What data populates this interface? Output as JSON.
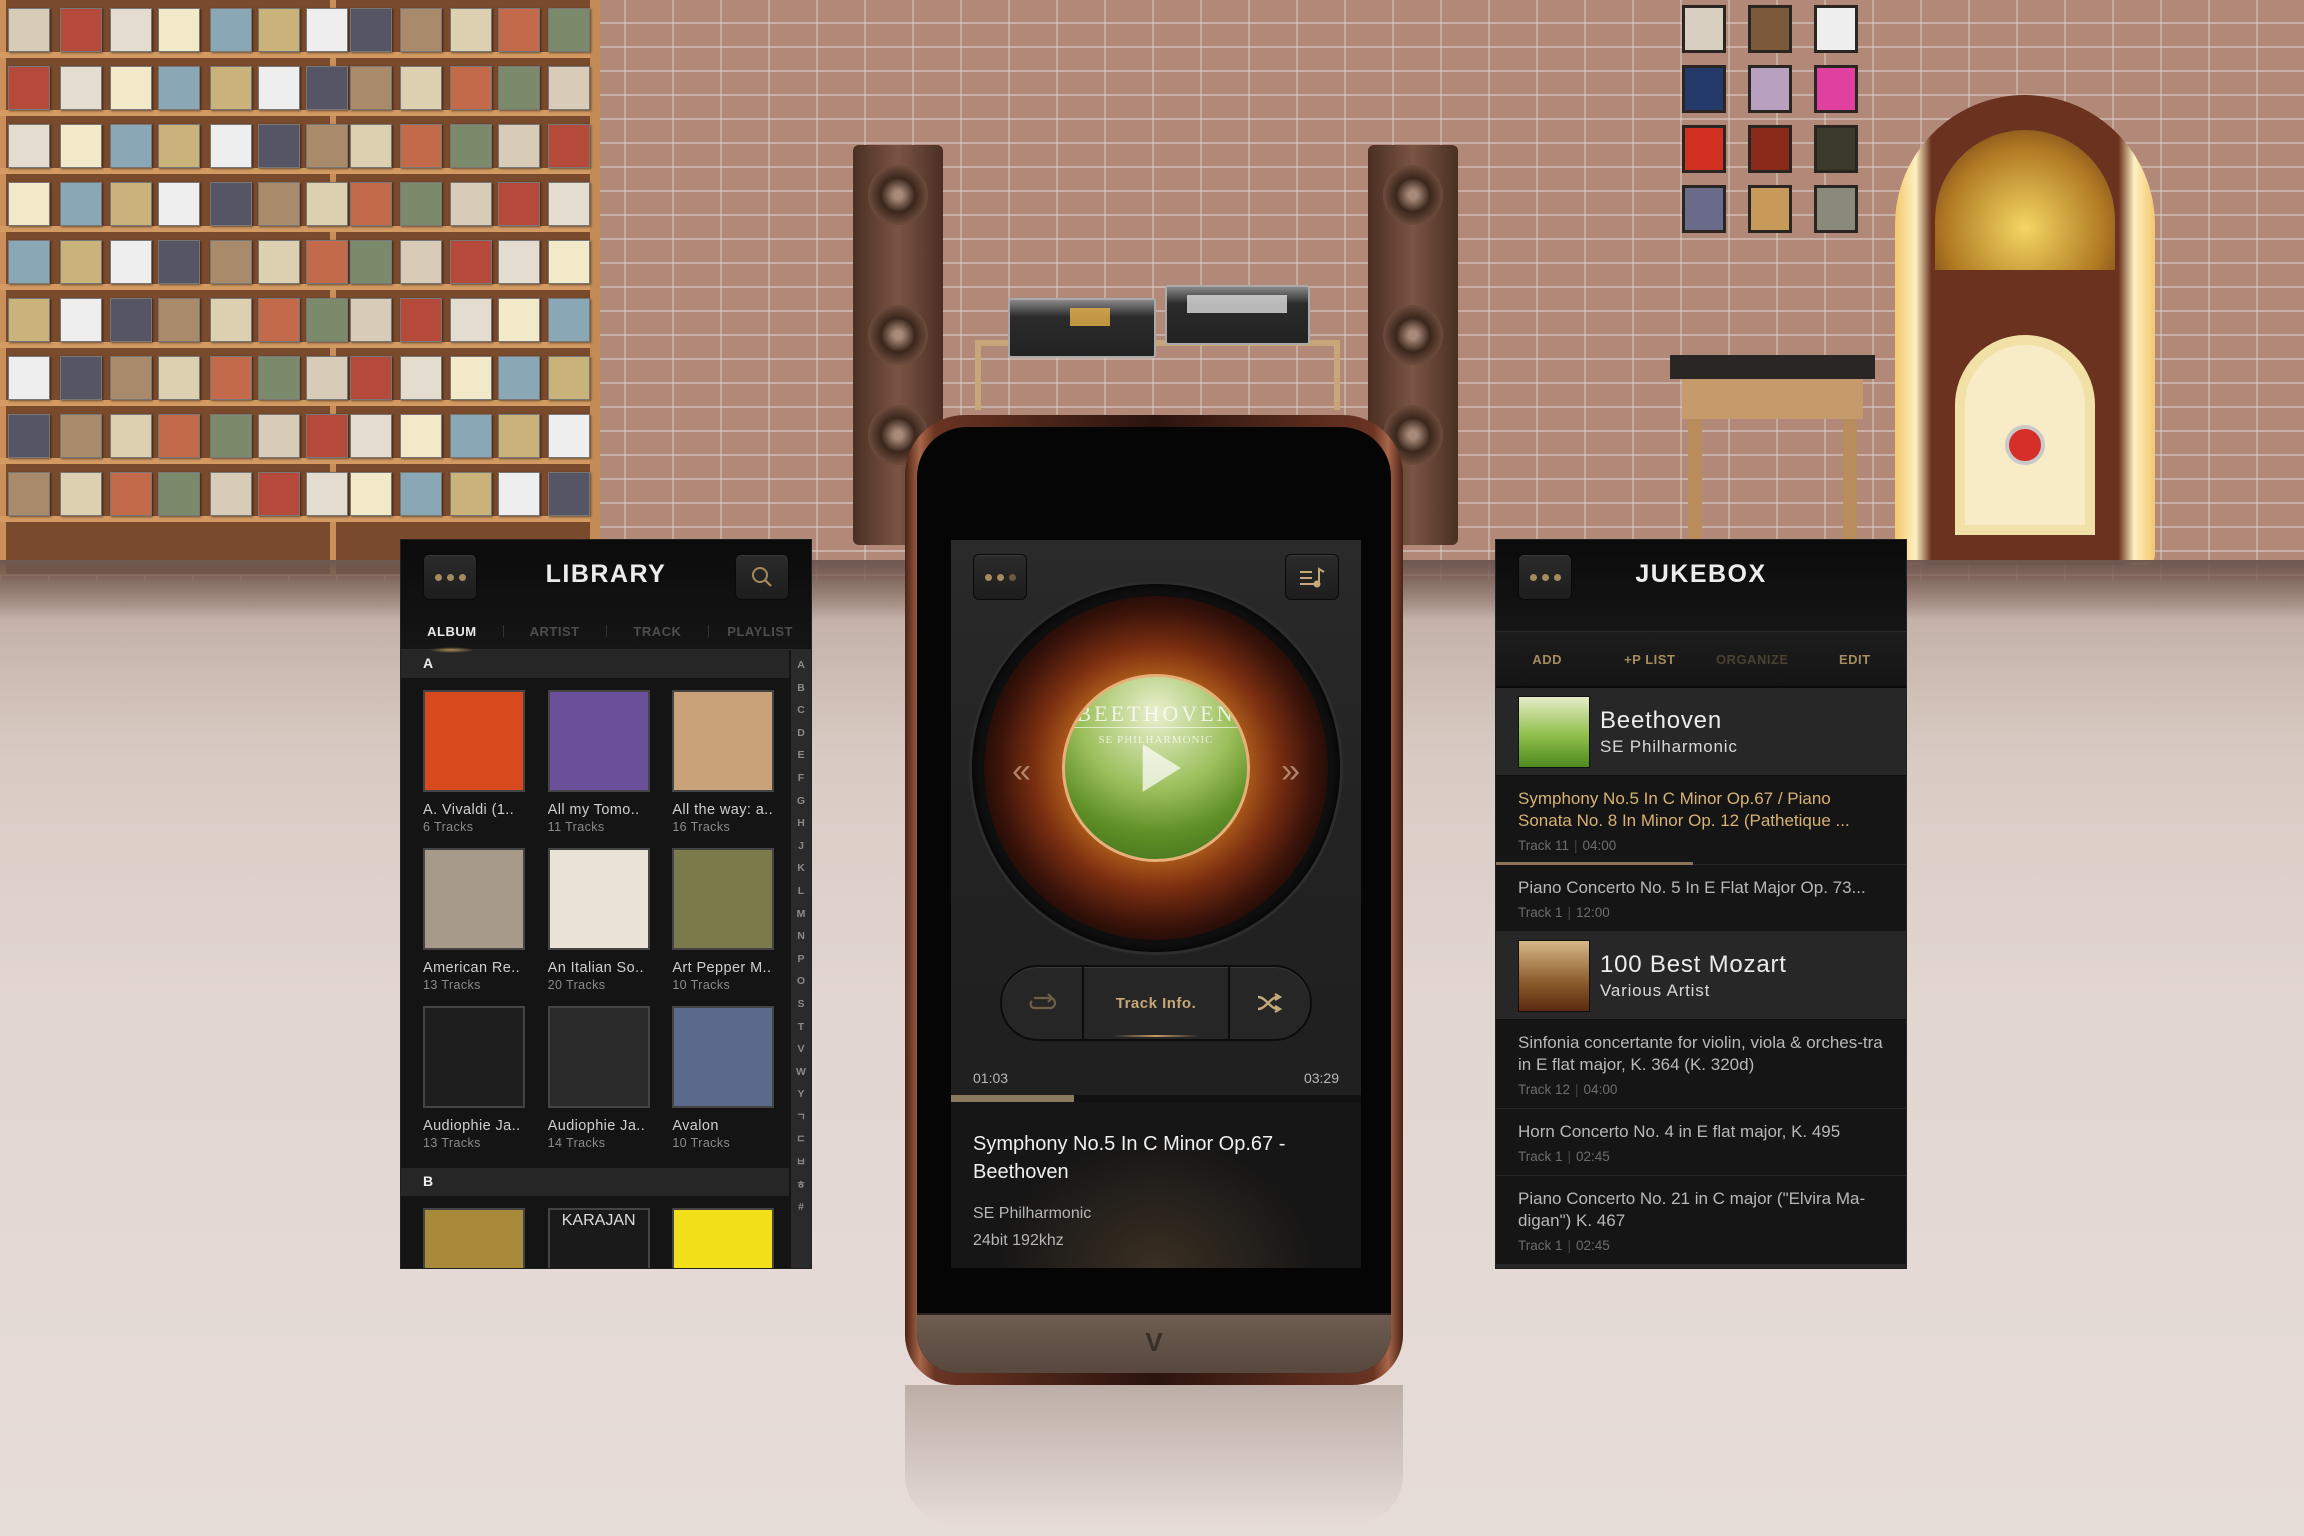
{
  "library": {
    "title": "LIBRARY",
    "tabs": [
      {
        "label": "ALBUM",
        "active": true
      },
      {
        "label": "ARTIST",
        "active": false
      },
      {
        "label": "TRACK",
        "active": false
      },
      {
        "label": "PLAYLIST",
        "active": false
      }
    ],
    "sections": [
      {
        "letter": "A",
        "albums": [
          {
            "title": "A. Vivaldi (1..",
            "tracks": "6 Tracks",
            "cover_color": "#d84a1e"
          },
          {
            "title": "All my Tomo..",
            "tracks": "11 Tracks",
            "cover_color": "#6a4f9a"
          },
          {
            "title": "All the way: a..",
            "tracks": "16 Tracks",
            "cover_color": "#c9a27a"
          },
          {
            "title": "American Re..",
            "tracks": "13 Tracks",
            "cover_color": "#a89a88"
          },
          {
            "title": "An Italian So..",
            "tracks": "20 Tracks",
            "cover_color": "#e9e3d6"
          },
          {
            "title": "Art Pepper M..",
            "tracks": "10 Tracks",
            "cover_color": "#7a7a4a"
          },
          {
            "title": "Audiophie Ja..",
            "tracks": "13 Tracks",
            "cover_color": "#1e1e1e"
          },
          {
            "title": "Audiophie Ja..",
            "tracks": "14 Tracks",
            "cover_color": "#2a2a2a"
          },
          {
            "title": "Avalon",
            "tracks": "10 Tracks",
            "cover_color": "#5a6a8a"
          }
        ]
      },
      {
        "letter": "B",
        "albums": [
          {
            "title": "",
            "tracks": "",
            "cover_color": "#a88a3a"
          },
          {
            "title": "",
            "tracks": "",
            "cover_label": "KARAJAN",
            "cover_color": "#1a1a1a"
          },
          {
            "title": "",
            "tracks": "",
            "cover_color": "#f2e01a"
          }
        ]
      }
    ],
    "index": [
      "A",
      "B",
      "C",
      "D",
      "E",
      "F",
      "G",
      "H",
      "J",
      "K",
      "L",
      "M",
      "N",
      "P",
      "O",
      "S",
      "T",
      "V",
      "W",
      "Y",
      "ㄱ",
      "ㄷ",
      "ㅂ",
      "ㅎ",
      "#"
    ]
  },
  "player": {
    "album_art_title": "BEETHOVEN",
    "album_art_subtitle": "SE PHILHARMONIC",
    "track_info_label": "Track Info.",
    "elapsed": "01:03",
    "duration": "03:29",
    "progress": 0.3,
    "track_title": "Symphony No.5 In C Minor Op.67 - Beethoven",
    "artist": "SE Philharmonic",
    "quality": "24bit 192khz",
    "accent_color": "#c5a77a"
  },
  "jukebox": {
    "title": "JUKEBOX",
    "actions": [
      {
        "label": "ADD",
        "enabled": true
      },
      {
        "label": "+P LIST",
        "enabled": true
      },
      {
        "label": "ORGANIZE",
        "enabled": false
      },
      {
        "label": "EDIT",
        "enabled": true
      }
    ],
    "groups": [
      {
        "album": "Beethoven",
        "artist": "SE Philharmonic",
        "tracks": [
          {
            "title": "Symphony No.5  In C Minor Op.67  /  Piano Sonata No. 8  In Minor Op. 12  (Pathetique ...",
            "track": "Track 11",
            "time": "04:00",
            "playing": true,
            "progress": 0.48
          },
          {
            "title": "Piano Concerto No. 5 In E Flat Major Op. 73...",
            "track": "Track 1",
            "time": "12:00",
            "playing": false
          }
        ]
      },
      {
        "album": "100 Best Mozart",
        "artist": "Various Artist",
        "tracks": [
          {
            "title": "Sinfonia concertante for violin, viola & orches-tra in E flat major, K. 364 (K. 320d)",
            "track": "Track 12",
            "time": "04:00",
            "playing": false
          },
          {
            "title": "Horn Concerto No. 4 in E flat major, K. 495",
            "track": "Track 1",
            "time": "02:45",
            "playing": false
          },
          {
            "title": "Piano Concerto No. 21 in C major (\"Elvira Ma-digan\") K. 467",
            "track": "Track 1",
            "time": "02:45",
            "playing": false
          }
        ]
      }
    ]
  }
}
